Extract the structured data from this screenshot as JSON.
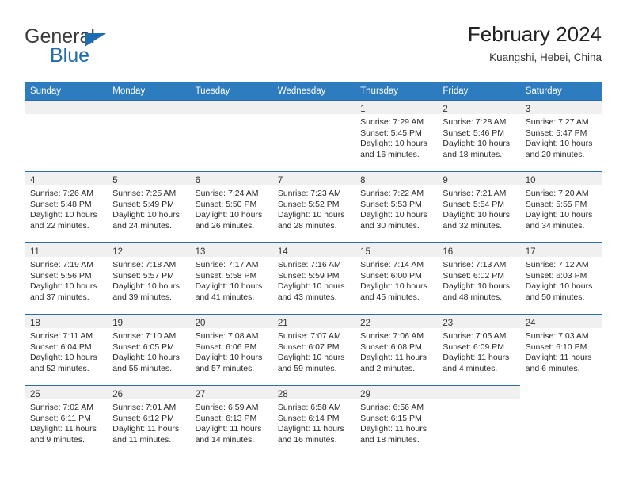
{
  "brand": {
    "word_one": "General",
    "word_two": "Blue",
    "triangle_color": "#1f6cb0"
  },
  "header": {
    "title": "February 2024",
    "subtitle": "Kuangshi, Hebei, China",
    "accent_color": "#2d7cc0"
  },
  "calendar": {
    "weekday_headers": [
      "Sunday",
      "Monday",
      "Tuesday",
      "Wednesday",
      "Thursday",
      "Friday",
      "Saturday"
    ],
    "labels": {
      "sunrise": "Sunrise:",
      "sunset": "Sunset:",
      "daylight": "Daylight:"
    },
    "weeks": [
      [
        {
          "day": "",
          "blank": true
        },
        {
          "day": "",
          "blank": true
        },
        {
          "day": "",
          "blank": true
        },
        {
          "day": "",
          "blank": true
        },
        {
          "day": "1",
          "sunrise": "Sunrise: 7:29 AM",
          "sunset": "Sunset: 5:45 PM",
          "daylight1": "Daylight: 10 hours",
          "daylight2": "and 16 minutes."
        },
        {
          "day": "2",
          "sunrise": "Sunrise: 7:28 AM",
          "sunset": "Sunset: 5:46 PM",
          "daylight1": "Daylight: 10 hours",
          "daylight2": "and 18 minutes."
        },
        {
          "day": "3",
          "sunrise": "Sunrise: 7:27 AM",
          "sunset": "Sunset: 5:47 PM",
          "daylight1": "Daylight: 10 hours",
          "daylight2": "and 20 minutes."
        }
      ],
      [
        {
          "day": "4",
          "sunrise": "Sunrise: 7:26 AM",
          "sunset": "Sunset: 5:48 PM",
          "daylight1": "Daylight: 10 hours",
          "daylight2": "and 22 minutes."
        },
        {
          "day": "5",
          "sunrise": "Sunrise: 7:25 AM",
          "sunset": "Sunset: 5:49 PM",
          "daylight1": "Daylight: 10 hours",
          "daylight2": "and 24 minutes."
        },
        {
          "day": "6",
          "sunrise": "Sunrise: 7:24 AM",
          "sunset": "Sunset: 5:50 PM",
          "daylight1": "Daylight: 10 hours",
          "daylight2": "and 26 minutes."
        },
        {
          "day": "7",
          "sunrise": "Sunrise: 7:23 AM",
          "sunset": "Sunset: 5:52 PM",
          "daylight1": "Daylight: 10 hours",
          "daylight2": "and 28 minutes."
        },
        {
          "day": "8",
          "sunrise": "Sunrise: 7:22 AM",
          "sunset": "Sunset: 5:53 PM",
          "daylight1": "Daylight: 10 hours",
          "daylight2": "and 30 minutes."
        },
        {
          "day": "9",
          "sunrise": "Sunrise: 7:21 AM",
          "sunset": "Sunset: 5:54 PM",
          "daylight1": "Daylight: 10 hours",
          "daylight2": "and 32 minutes."
        },
        {
          "day": "10",
          "sunrise": "Sunrise: 7:20 AM",
          "sunset": "Sunset: 5:55 PM",
          "daylight1": "Daylight: 10 hours",
          "daylight2": "and 34 minutes."
        }
      ],
      [
        {
          "day": "11",
          "sunrise": "Sunrise: 7:19 AM",
          "sunset": "Sunset: 5:56 PM",
          "daylight1": "Daylight: 10 hours",
          "daylight2": "and 37 minutes."
        },
        {
          "day": "12",
          "sunrise": "Sunrise: 7:18 AM",
          "sunset": "Sunset: 5:57 PM",
          "daylight1": "Daylight: 10 hours",
          "daylight2": "and 39 minutes."
        },
        {
          "day": "13",
          "sunrise": "Sunrise: 7:17 AM",
          "sunset": "Sunset: 5:58 PM",
          "daylight1": "Daylight: 10 hours",
          "daylight2": "and 41 minutes."
        },
        {
          "day": "14",
          "sunrise": "Sunrise: 7:16 AM",
          "sunset": "Sunset: 5:59 PM",
          "daylight1": "Daylight: 10 hours",
          "daylight2": "and 43 minutes."
        },
        {
          "day": "15",
          "sunrise": "Sunrise: 7:14 AM",
          "sunset": "Sunset: 6:00 PM",
          "daylight1": "Daylight: 10 hours",
          "daylight2": "and 45 minutes."
        },
        {
          "day": "16",
          "sunrise": "Sunrise: 7:13 AM",
          "sunset": "Sunset: 6:02 PM",
          "daylight1": "Daylight: 10 hours",
          "daylight2": "and 48 minutes."
        },
        {
          "day": "17",
          "sunrise": "Sunrise: 7:12 AM",
          "sunset": "Sunset: 6:03 PM",
          "daylight1": "Daylight: 10 hours",
          "daylight2": "and 50 minutes."
        }
      ],
      [
        {
          "day": "18",
          "sunrise": "Sunrise: 7:11 AM",
          "sunset": "Sunset: 6:04 PM",
          "daylight1": "Daylight: 10 hours",
          "daylight2": "and 52 minutes."
        },
        {
          "day": "19",
          "sunrise": "Sunrise: 7:10 AM",
          "sunset": "Sunset: 6:05 PM",
          "daylight1": "Daylight: 10 hours",
          "daylight2": "and 55 minutes."
        },
        {
          "day": "20",
          "sunrise": "Sunrise: 7:08 AM",
          "sunset": "Sunset: 6:06 PM",
          "daylight1": "Daylight: 10 hours",
          "daylight2": "and 57 minutes."
        },
        {
          "day": "21",
          "sunrise": "Sunrise: 7:07 AM",
          "sunset": "Sunset: 6:07 PM",
          "daylight1": "Daylight: 10 hours",
          "daylight2": "and 59 minutes."
        },
        {
          "day": "22",
          "sunrise": "Sunrise: 7:06 AM",
          "sunset": "Sunset: 6:08 PM",
          "daylight1": "Daylight: 11 hours",
          "daylight2": "and 2 minutes."
        },
        {
          "day": "23",
          "sunrise": "Sunrise: 7:05 AM",
          "sunset": "Sunset: 6:09 PM",
          "daylight1": "Daylight: 11 hours",
          "daylight2": "and 4 minutes."
        },
        {
          "day": "24",
          "sunrise": "Sunrise: 7:03 AM",
          "sunset": "Sunset: 6:10 PM",
          "daylight1": "Daylight: 11 hours",
          "daylight2": "and 6 minutes."
        }
      ],
      [
        {
          "day": "25",
          "sunrise": "Sunrise: 7:02 AM",
          "sunset": "Sunset: 6:11 PM",
          "daylight1": "Daylight: 11 hours",
          "daylight2": "and 9 minutes."
        },
        {
          "day": "26",
          "sunrise": "Sunrise: 7:01 AM",
          "sunset": "Sunset: 6:12 PM",
          "daylight1": "Daylight: 11 hours",
          "daylight2": "and 11 minutes."
        },
        {
          "day": "27",
          "sunrise": "Sunrise: 6:59 AM",
          "sunset": "Sunset: 6:13 PM",
          "daylight1": "Daylight: 11 hours",
          "daylight2": "and 14 minutes."
        },
        {
          "day": "28",
          "sunrise": "Sunrise: 6:58 AM",
          "sunset": "Sunset: 6:14 PM",
          "daylight1": "Daylight: 11 hours",
          "daylight2": "and 16 minutes."
        },
        {
          "day": "29",
          "sunrise": "Sunrise: 6:56 AM",
          "sunset": "Sunset: 6:15 PM",
          "daylight1": "Daylight: 11 hours",
          "daylight2": "and 18 minutes."
        },
        {
          "day": "",
          "blank": true
        },
        {
          "day": "",
          "blank": true,
          "empty": true
        }
      ]
    ]
  }
}
